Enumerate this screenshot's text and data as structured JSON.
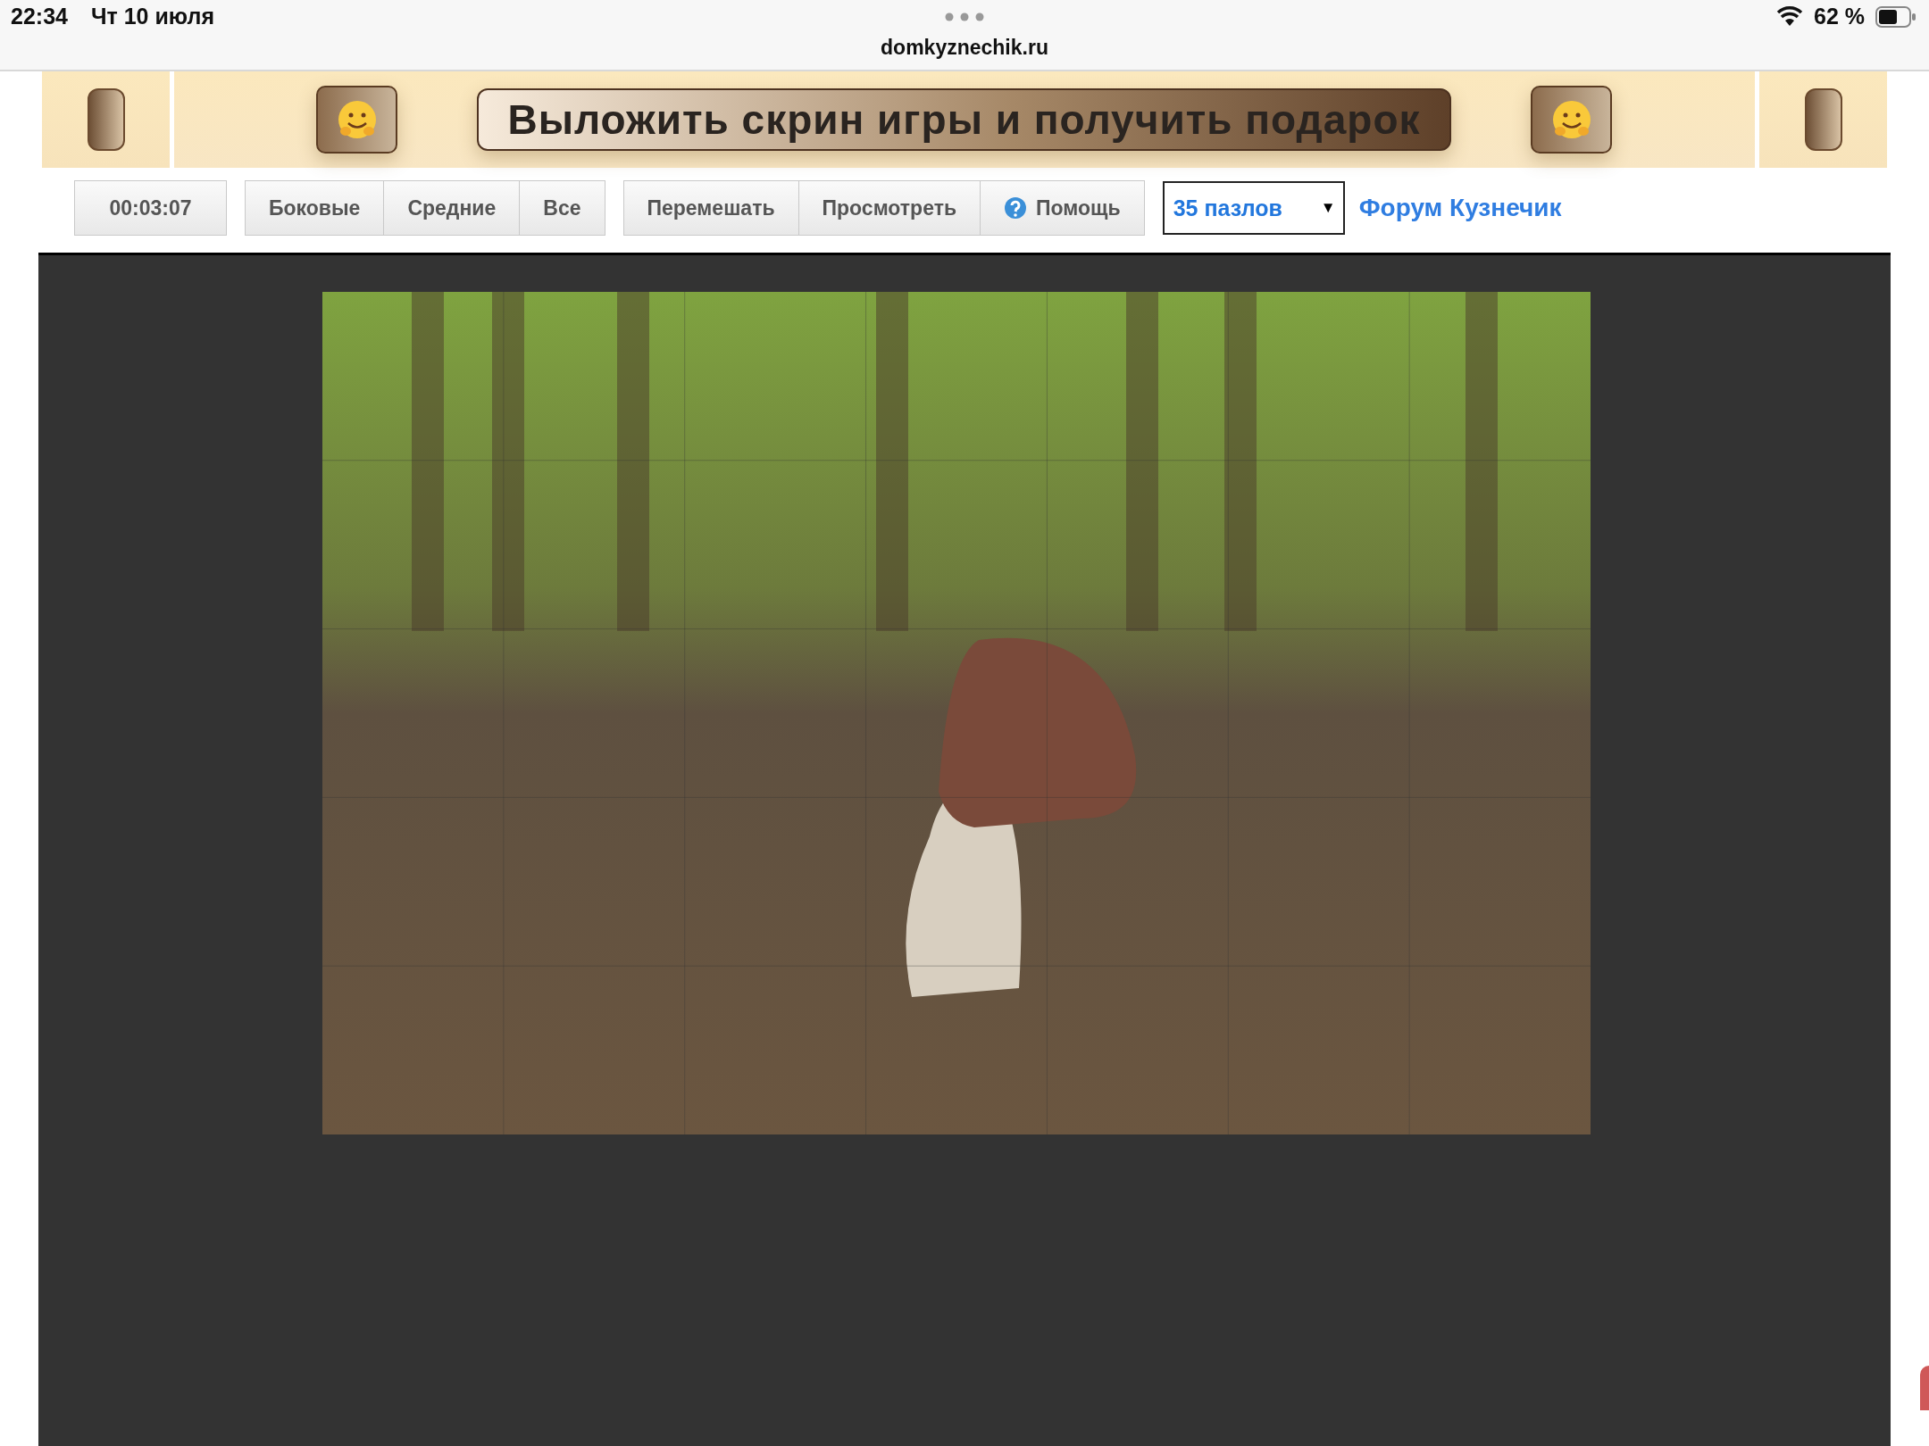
{
  "status_bar": {
    "time": "22:34",
    "date": "Чт 10 июля",
    "battery_text": "62 %"
  },
  "address_bar": {
    "url": "domkyznechik.ru"
  },
  "banner": {
    "text": "Выложить скрин игры и получить подарок"
  },
  "toolbar": {
    "timer": "00:03:07",
    "view_buttons": [
      "Боковые",
      "Средние",
      "Все"
    ],
    "action_buttons": [
      {
        "label": "Перемешать",
        "kind": "plain"
      },
      {
        "label": "Просмотреть",
        "kind": "plain"
      },
      {
        "label": "Помощь",
        "kind": "help"
      }
    ],
    "pieces_select": {
      "value": "35 пазлов",
      "arrow": "▼"
    },
    "forum_link": "Форум Кузнечик"
  }
}
